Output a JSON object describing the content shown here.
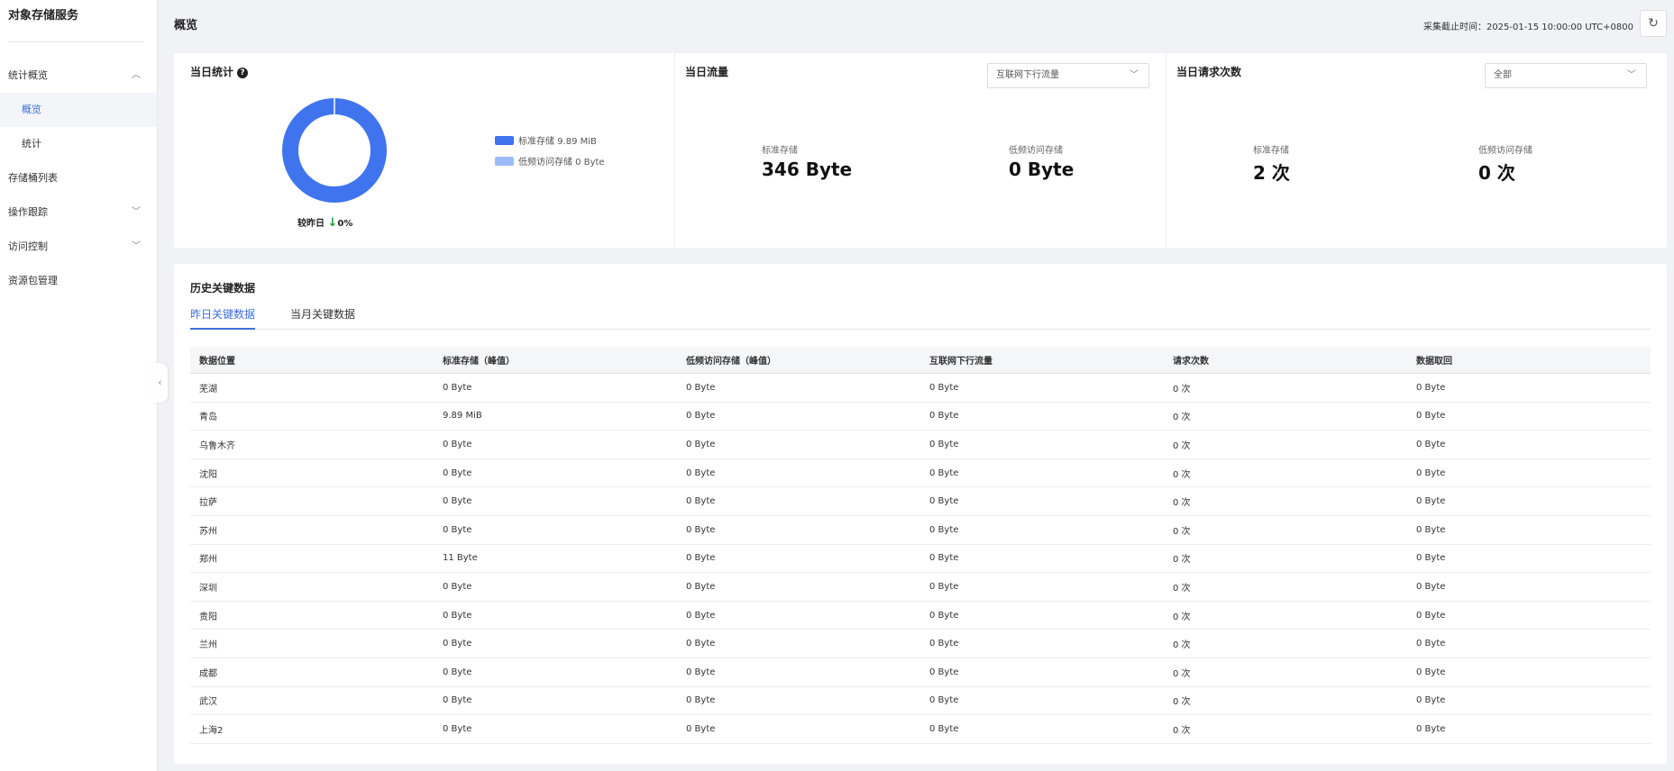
{
  "sidebar": {
    "title": "对象存储服务",
    "items": [
      {
        "label": "统计概览",
        "chevron": "up"
      },
      {
        "label": "概览",
        "child": true,
        "active": true
      },
      {
        "label": "统计",
        "child": true
      },
      {
        "label": "存储桶列表"
      },
      {
        "label": "操作跟踪",
        "chevron": "down"
      },
      {
        "label": "访问控制",
        "chevron": "down"
      },
      {
        "label": "资源包管理"
      }
    ]
  },
  "header": {
    "title": "概览",
    "collect_time": "采集截止时间：2025-01-15 10:00:00 UTC+0800"
  },
  "daily_stats": {
    "title": "当日统计",
    "legend": [
      {
        "label": "标准存储 9.89 MiB",
        "color": "#3f74ee"
      },
      {
        "label": "低频访问存储 0 Byte",
        "color": "#9dbcf7"
      }
    ],
    "compare_label": "较昨日",
    "compare_value": "0%"
  },
  "daily_traffic": {
    "title": "当日流量",
    "select_value": "互联网下行流量",
    "metrics": [
      {
        "label": "标准存储",
        "value": "346 Byte"
      },
      {
        "label": "低频访问存储",
        "value": "0 Byte"
      }
    ]
  },
  "daily_requests": {
    "title": "当日请求次数",
    "select_value": "全部",
    "metrics": [
      {
        "label": "标准存储",
        "value": "2 次"
      },
      {
        "label": "低频访问存储",
        "value": "0 次"
      }
    ]
  },
  "history": {
    "title": "历史关键数据",
    "tabs": [
      "昨日关键数据",
      "当月关键数据"
    ],
    "columns": [
      "数据位置",
      "标准存储（峰值）",
      "低频访问存储（峰值）",
      "互联网下行流量",
      "请求次数",
      "数据取回"
    ],
    "rows": [
      [
        "芜湖",
        "0 Byte",
        "0 Byte",
        "0 Byte",
        "0 次",
        "0 Byte"
      ],
      [
        "青岛",
        "9.89 MiB",
        "0 Byte",
        "0 Byte",
        "0 次",
        "0 Byte"
      ],
      [
        "乌鲁木齐",
        "0 Byte",
        "0 Byte",
        "0 Byte",
        "0 次",
        "0 Byte"
      ],
      [
        "沈阳",
        "0 Byte",
        "0 Byte",
        "0 Byte",
        "0 次",
        "0 Byte"
      ],
      [
        "拉萨",
        "0 Byte",
        "0 Byte",
        "0 Byte",
        "0 次",
        "0 Byte"
      ],
      [
        "苏州",
        "0 Byte",
        "0 Byte",
        "0 Byte",
        "0 次",
        "0 Byte"
      ],
      [
        "郑州",
        "11 Byte",
        "0 Byte",
        "0 Byte",
        "0 次",
        "0 Byte"
      ],
      [
        "深圳",
        "0 Byte",
        "0 Byte",
        "0 Byte",
        "0 次",
        "0 Byte"
      ],
      [
        "贵阳",
        "0 Byte",
        "0 Byte",
        "0 Byte",
        "0 次",
        "0 Byte"
      ],
      [
        "兰州",
        "0 Byte",
        "0 Byte",
        "0 Byte",
        "0 次",
        "0 Byte"
      ],
      [
        "成都",
        "0 Byte",
        "0 Byte",
        "0 Byte",
        "0 次",
        "0 Byte"
      ],
      [
        "武汉",
        "0 Byte",
        "0 Byte",
        "0 Byte",
        "0 次",
        "0 Byte"
      ],
      [
        "上海2",
        "0 Byte",
        "0 Byte",
        "0 Byte",
        "0 次",
        "0 Byte"
      ]
    ]
  },
  "icons": {
    "refresh": "refresh-icon",
    "help": "help-icon",
    "collapse": "chevron-left-icon",
    "arrow_down": "arrow-down-icon"
  }
}
